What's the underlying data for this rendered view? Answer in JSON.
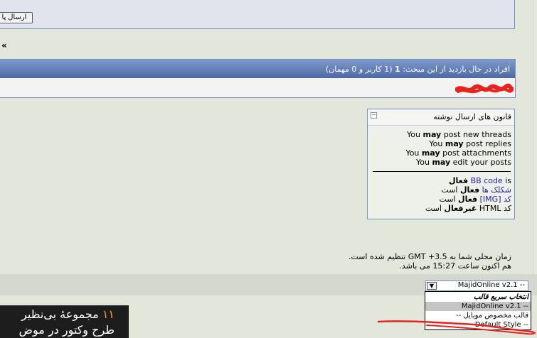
{
  "reply": {
    "send_label": "ارسال پا"
  },
  "nav": {
    "guillemet": "«"
  },
  "browsing": {
    "prefix": "افراد در حال بازدید از این مبحث:",
    "count": "1",
    "detail": "(1 کاربر و 0 مهمان)"
  },
  "rules": {
    "title": "قانون های ارسال نوشته",
    "collapse_glyph": "−",
    "lines_en": [
      {
        "pre": "You ",
        "bold": "may",
        "post": " post new threads"
      },
      {
        "pre": "You ",
        "bold": "may",
        "post": " post replies"
      },
      {
        "pre": "You ",
        "bold": "may",
        "post": " post attachments"
      },
      {
        "pre": "You ",
        "bold": "may",
        "post": " edit your posts"
      }
    ],
    "bbcode": {
      "link": "BB code",
      "is": "is",
      "state": "فعال"
    },
    "smilies": {
      "link": "شکلک ها",
      "state": "فعال",
      "suffix": "است"
    },
    "img": {
      "link": "کد [IMG]",
      "state": "فعال",
      "suffix": "است"
    },
    "html": {
      "label": "کد HTML",
      "state": "غیرفعال",
      "suffix": "است"
    }
  },
  "time": {
    "line1": "زمان محلی شما به GMT +3.5 تنظیم شده است.",
    "line2": "هم اکنون ساعت 15:27 می باشد."
  },
  "style_select": {
    "value": "MajidOnline v2.1 --",
    "arrow_glyph": "▼",
    "options": [
      {
        "label": "انتخاب سریع قالب",
        "selected": false
      },
      {
        "label": "MajidOnline v2.1 --",
        "selected": true
      },
      {
        "label": "-- قالب مخصوص موبایل",
        "selected": false
      },
      {
        "label": "Default Style --",
        "selected": false
      }
    ]
  },
  "promo": {
    "number": "۱۱",
    "line1": "مجموعهٔ بی‌نظیر",
    "line2": "طرح وکتور در موض"
  },
  "colors": {
    "header_blue": "#5a75ad",
    "panel_border": "#7a8fb7",
    "scribble_red": "#e8231e",
    "promo_orange": "#f5a02a"
  }
}
